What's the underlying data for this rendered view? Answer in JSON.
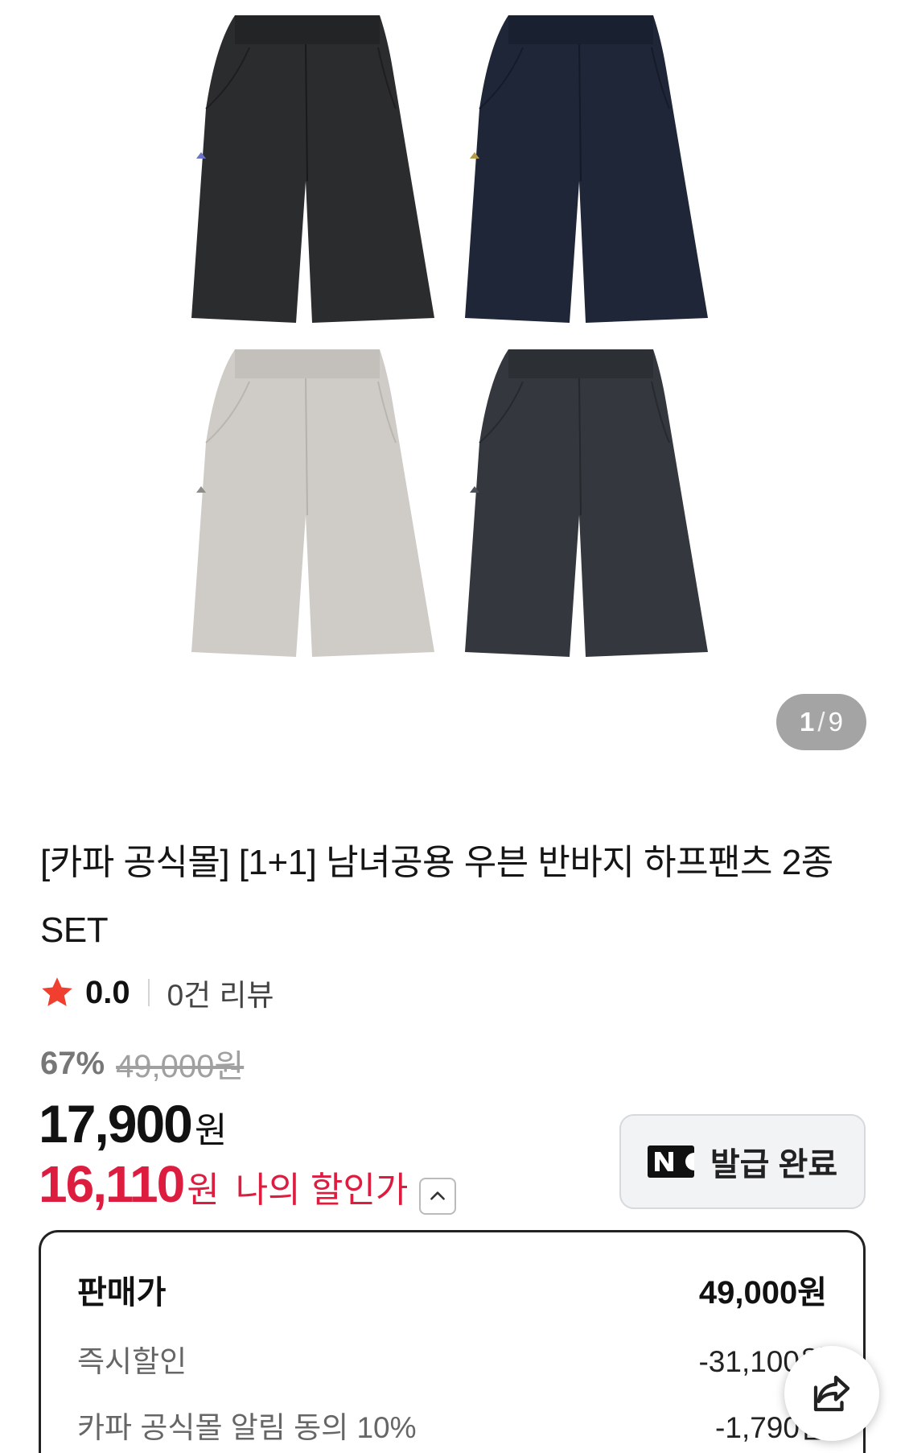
{
  "gallery": {
    "current": "1",
    "separator": "/",
    "total": "9",
    "product_colors": [
      "#2b2c2e",
      "#1e2638",
      "#cfccc7",
      "#34373d"
    ]
  },
  "product": {
    "title": "[카파 공식몰] [1+1] 남녀공용 우븐 반바지 하프팬츠 2종 SET",
    "rating_score": "0.0",
    "review_count": "0건 리뷰"
  },
  "pricing": {
    "discount_rate": "67%",
    "original_price": "49,000원",
    "sale_price": "17,900",
    "sale_currency": "원",
    "my_price": "16,110",
    "my_currency": "원",
    "my_price_label": "나의 할인가"
  },
  "coupon": {
    "label": "발급 완료"
  },
  "breakdown": {
    "rows": [
      {
        "label": "판매가",
        "value": "49,000원"
      },
      {
        "label": "즉시할인",
        "value": "-31,100원"
      },
      {
        "label": "카파 공식몰 알림 동의 10%",
        "value": "-1,790원"
      }
    ]
  },
  "colors": {
    "accent_red": "#dd1d3f",
    "star": "#f03e2f",
    "naver": "#111111"
  }
}
